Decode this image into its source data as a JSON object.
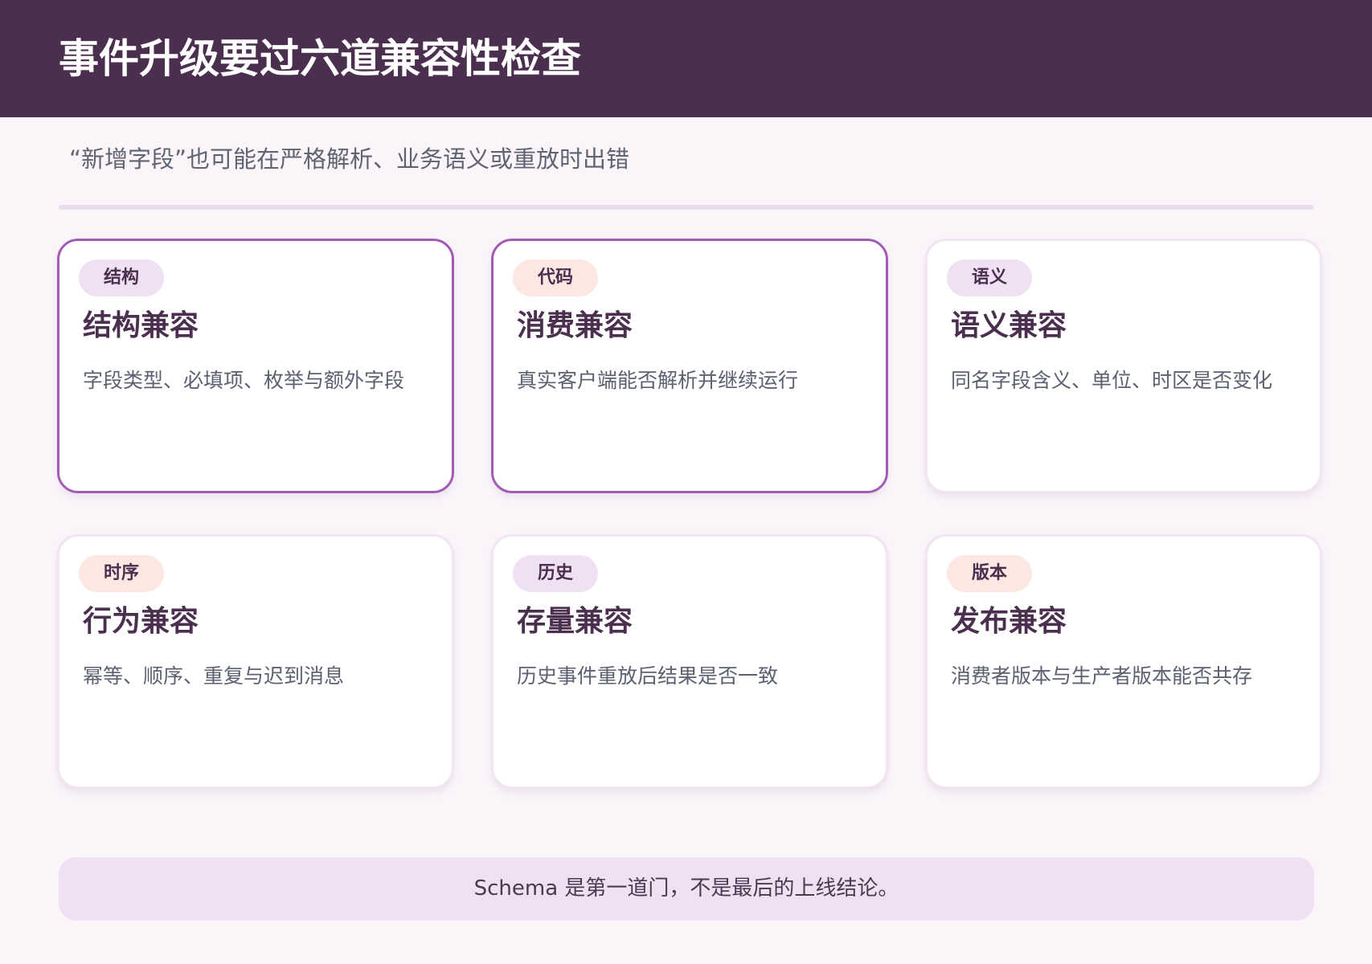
{
  "header": {
    "title": "事件升级要过六道兼容性检查"
  },
  "subtitle": "“新增字段”也可能在严格解析、业务语义或重放时出错",
  "cards": [
    {
      "tag": "结构",
      "title": "结构兼容",
      "desc": "字段类型、必填项、枚举与额外字段",
      "highlighted": true,
      "tag_color": "violet"
    },
    {
      "tag": "代码",
      "title": "消费兼容",
      "desc": "真实客户端能否解析并继续运行",
      "highlighted": true,
      "tag_color": "peach"
    },
    {
      "tag": "语义",
      "title": "语义兼容",
      "desc": "同名字段含义、单位、时区是否变化",
      "highlighted": false,
      "tag_color": "violet"
    },
    {
      "tag": "时序",
      "title": "行为兼容",
      "desc": "幂等、顺序、重复与迟到消息",
      "highlighted": false,
      "tag_color": "peach"
    },
    {
      "tag": "历史",
      "title": "存量兼容",
      "desc": "历史事件重放后结果是否一致",
      "highlighted": false,
      "tag_color": "violet"
    },
    {
      "tag": "版本",
      "title": "发布兼容",
      "desc": "消费者版本与生产者版本能否共存",
      "highlighted": false,
      "tag_color": "peach"
    }
  ],
  "footer": {
    "text": "Schema 是第一道门，不是最后的上线结论。"
  },
  "colors": {
    "header_bg": "#4b2f4e",
    "page_bg": "#fbf5fa",
    "highlight_border": "#a25cb5",
    "chip_violet": "#efe1f3",
    "chip_peach": "#fce7e2",
    "footer_bg": "#efe1f3"
  }
}
